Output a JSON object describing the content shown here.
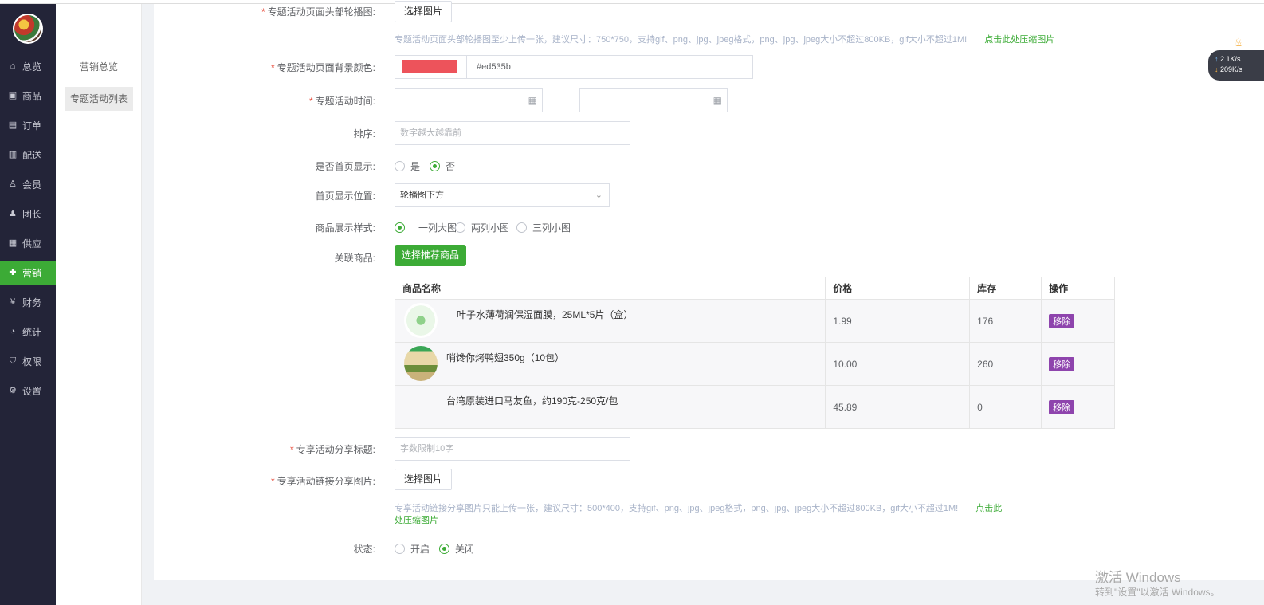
{
  "sidebar": {
    "items": [
      {
        "label": "总览",
        "icon": "home-icon"
      },
      {
        "label": "商品",
        "icon": "goods-icon"
      },
      {
        "label": "订单",
        "icon": "order-icon"
      },
      {
        "label": "配送",
        "icon": "delivery-icon"
      },
      {
        "label": "会员",
        "icon": "member-icon"
      },
      {
        "label": "团长",
        "icon": "leader-icon"
      },
      {
        "label": "供应",
        "icon": "supply-icon"
      },
      {
        "label": "营销",
        "icon": "gift-icon"
      },
      {
        "label": "财务",
        "icon": "finance-icon"
      },
      {
        "label": "统计",
        "icon": "stats-icon"
      },
      {
        "label": "权限",
        "icon": "permission-icon"
      },
      {
        "label": "设置",
        "icon": "settings-icon"
      }
    ],
    "active": "营销"
  },
  "subnav": {
    "items": [
      "营销总览",
      "专题活动列表"
    ],
    "active": "专题活动列表"
  },
  "form": {
    "banner": {
      "label": "专题活动页面头部轮播图:",
      "button": "选择图片",
      "tip": "专题活动页面头部轮播图至少上传一张，建议尺寸：750*750，支持gif、png、jpg、jpeg格式，png、jpg、jpeg大小不超过800KB，gif大小不超过1M!",
      "link": "点击此处压缩图片"
    },
    "bg_color": {
      "label": "专题活动页面背景颜色:",
      "value": "#ed535b",
      "swatch": "#ed535b"
    },
    "time": {
      "label": "专题活动时间:",
      "separator": "—"
    },
    "sort": {
      "label": "排序:",
      "placeholder": "数字越大越靠前"
    },
    "homepage": {
      "label": "是否首页显示:",
      "options": [
        "是",
        "否"
      ],
      "selected": "否"
    },
    "position": {
      "label": "首页显示位置:",
      "value": "轮播图下方"
    },
    "style": {
      "label": "商品展示样式:",
      "options": [
        "一列大图",
        "两列小图",
        "三列小图"
      ],
      "selected": "一列大图"
    },
    "related": {
      "label": "关联商品:",
      "button": "选择推荐商品"
    },
    "share_title": {
      "label": "专享活动分享标题:",
      "placeholder": "字数限制10字"
    },
    "share_image": {
      "label": "专享活动链接分享图片:",
      "button": "选择图片",
      "tip": "专享活动链接分享图片只能上传一张，建议尺寸：500*400，支持gif、png、jpg、jpeg格式，png、jpg、jpeg大小不超过800KB，gif大小不超过1M!",
      "link1": "点击此",
      "link2": "处压缩图片"
    },
    "status": {
      "label": "状态:",
      "options": [
        "开启",
        "关闭"
      ],
      "selected": "关闭"
    }
  },
  "goods_table": {
    "headers": [
      "商品名称",
      "价格",
      "库存",
      "操作"
    ],
    "rows": [
      {
        "name": "叶子水薄荷润保湿面膜，25ML*5片（盒）",
        "price": "1.99",
        "stock": "176",
        "action": "移除"
      },
      {
        "name": "哨馋你烤鸭翅350g（10包）",
        "price": "10.00",
        "stock": "260",
        "action": "移除"
      },
      {
        "name": "台湾原装进口马友鱼，约190克-250克/包",
        "price": "45.89",
        "stock": "0",
        "action": "移除"
      }
    ]
  },
  "network": {
    "up": "2.1K/s",
    "down": "209K/s"
  },
  "watermark": {
    "line1": "激活 Windows",
    "line2": "转到\"设置\"以激活 Windows。"
  }
}
